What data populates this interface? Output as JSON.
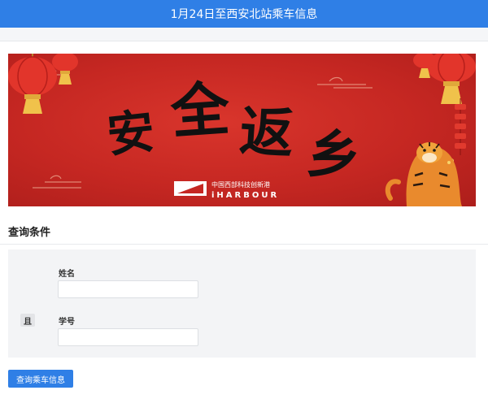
{
  "header": {
    "title": "1月24日至西安北站乘车信息"
  },
  "banner": {
    "headline": [
      "安",
      "全",
      "返",
      "乡"
    ],
    "brand_cn": "中国西部科技创新港",
    "brand_en": "iHARBOUR",
    "icons": [
      "lantern-icon",
      "firecracker-icon",
      "tiger-illustration",
      "cloud-pattern"
    ],
    "colors": {
      "background": "#c52722",
      "ink": "#111111",
      "gold": "#f0c24b"
    }
  },
  "query": {
    "section_title": "查询条件",
    "logic_operator": "且",
    "fields": [
      {
        "label": "姓名",
        "value": "",
        "placeholder": ""
      },
      {
        "label": "学号",
        "value": "",
        "placeholder": ""
      }
    ],
    "submit_label": "查询乘车信息"
  },
  "colors": {
    "accent": "#2f7fe6",
    "panel": "#f3f4f6"
  }
}
